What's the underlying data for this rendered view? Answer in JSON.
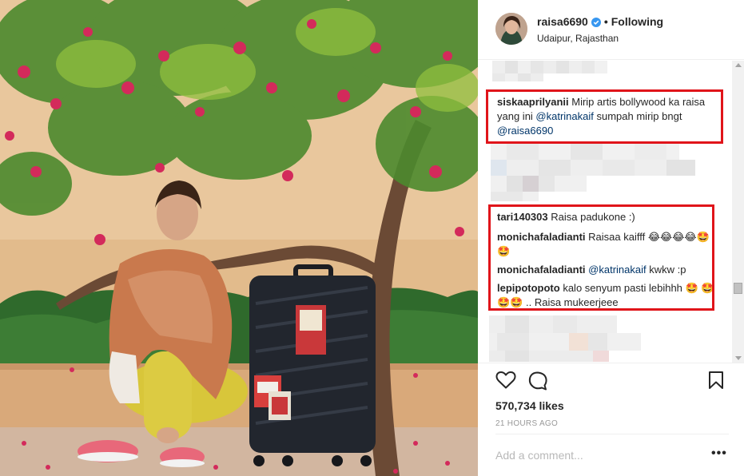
{
  "post": {
    "username": "raisa6690",
    "follow_state": "Following",
    "separator": "•",
    "location": "Udaipur, Rajasthan",
    "verified_color": "#3897f0"
  },
  "comments": [
    {
      "user": "siskaaprilyanii",
      "parts": [
        "Mirip artis bollywood ka raisa yang ini ",
        "@katrinakaif",
        " sumpah mirip bngt ",
        "@raisa6690"
      ]
    },
    {
      "user": "tari140303",
      "text": "Raisa padukone :)"
    },
    {
      "user": "monichafaladianti",
      "text": "Raisaa kaifff 😂😂😂😂🤩 🤩"
    },
    {
      "user": "monichafaladianti",
      "mention": "@katrinakaif",
      "text": " kwkw :p"
    },
    {
      "user": "lepipotopoto",
      "text": "kalo senyum pasti lebihhh 🤩 🤩🤩🤩 .. Raisa mukeerjeee"
    }
  ],
  "stats": {
    "likes": "570,734 likes",
    "timestamp": "21 HOURS AGO"
  },
  "composer": {
    "placeholder": "Add a comment...",
    "more_label": "•••"
  },
  "icons": {
    "like": "heart-icon",
    "comment": "speech-bubble-icon",
    "save": "bookmark-icon",
    "verified": "verified-badge-icon"
  },
  "colors": {
    "highlight": "#e0141a",
    "mention": "#003569",
    "muted": "#999999"
  }
}
